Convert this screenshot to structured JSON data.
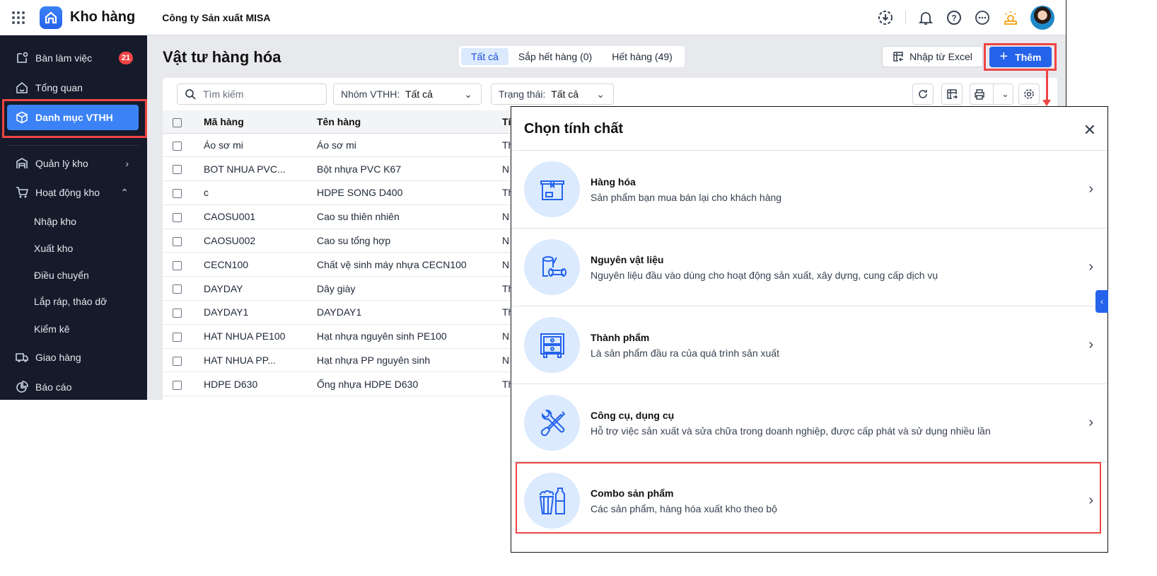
{
  "app": {
    "name": "Kho hàng",
    "company": "Công ty Sản xuất MISA"
  },
  "sidebar": {
    "items": [
      {
        "label": "Bàn làm việc",
        "badge": "21",
        "icon": "desk-icon"
      },
      {
        "label": "Tổng quan",
        "icon": "home-icon"
      },
      {
        "label": "Danh mục VTHH",
        "icon": "box-icon",
        "active": true
      },
      {
        "label": "Quản lý kho",
        "icon": "warehouse-icon"
      },
      {
        "label": "Hoạt động kho",
        "icon": "cart-icon"
      },
      {
        "label": "Nhập kho"
      },
      {
        "label": "Xuất kho"
      },
      {
        "label": "Điều chuyển"
      },
      {
        "label": "Lắp ráp, tháo dỡ"
      },
      {
        "label": "Kiểm kê"
      },
      {
        "label": "Giao hàng",
        "icon": "truck-icon"
      },
      {
        "label": "Báo cáo",
        "icon": "chart-icon"
      }
    ]
  },
  "main": {
    "title": "Vật tư hàng hóa",
    "tabs": [
      {
        "label": "Tất cả"
      },
      {
        "label": "Sắp hết hàng (0)"
      },
      {
        "label": "Hết hàng (49)"
      }
    ],
    "import_label": "Nhập từ Excel",
    "add_label": "Thêm",
    "search_placeholder": "Tìm kiếm",
    "filter_group": {
      "label": "Nhóm VTHH:",
      "value": "Tất cả"
    },
    "filter_status": {
      "label": "Trạng thái:",
      "value": "Tất cả"
    },
    "columns": [
      "Mã hàng",
      "Tên hàng",
      "Tí"
    ],
    "rows": [
      [
        "Áo sơ mi",
        "Áo sơ mi",
        "Th"
      ],
      [
        "BOT NHUA PVC...",
        "Bột nhựa PVC K67",
        "N"
      ],
      [
        "c",
        "HDPE SONG D400",
        "Th"
      ],
      [
        "CAOSU001",
        "Cao su thiên nhiên",
        "N"
      ],
      [
        "CAOSU002",
        "Cao su tổng hợp",
        "N"
      ],
      [
        "CECN100",
        "Chất vệ sinh máy nhựa CECN100",
        "N"
      ],
      [
        "DAYDAY",
        "Dây giày",
        "Th"
      ],
      [
        "DAYDAY1",
        "DAYDAY1",
        "Th"
      ],
      [
        "HAT NHUA PE100",
        "Hạt nhựa nguyên sinh PE100",
        "N"
      ],
      [
        "HAT NHUA PP...",
        "Hạt nhựa PP nguyên sinh",
        "N"
      ],
      [
        "HDPE D630",
        "Ống nhựa HDPE D630",
        "Th"
      ]
    ]
  },
  "dialog": {
    "title": "Chọn tính chất",
    "options": [
      {
        "name": "Hàng hóa",
        "desc": "Sản phẩm bạn mua bán lại cho khách hàng",
        "icon": "package-icon"
      },
      {
        "name": "Nguyên vật liệu",
        "desc": "Nguyên liệu đầu vào dùng cho hoạt động sản xuất, xây dựng, cung cấp dịch vụ",
        "icon": "logs-icon"
      },
      {
        "name": "Thành phẩm",
        "desc": "Là sản phẩm đầu ra của quá trình sản xuất",
        "icon": "cabinet-icon"
      },
      {
        "name": "Công cụ, dụng cụ",
        "desc": "Hỗ trợ việc sản xuất và sửa chữa trong doanh nghiệp, được cấp phát và sử dụng nhiều lần",
        "icon": "tools-icon"
      },
      {
        "name": "Combo sản phẩm",
        "desc": "Các sản phẩm, hàng hóa xuất kho theo bộ",
        "icon": "combo-icon"
      }
    ]
  },
  "colors": {
    "primary": "#2563eb",
    "sidebar": "#151b2b",
    "highlight": "#ef4444"
  }
}
